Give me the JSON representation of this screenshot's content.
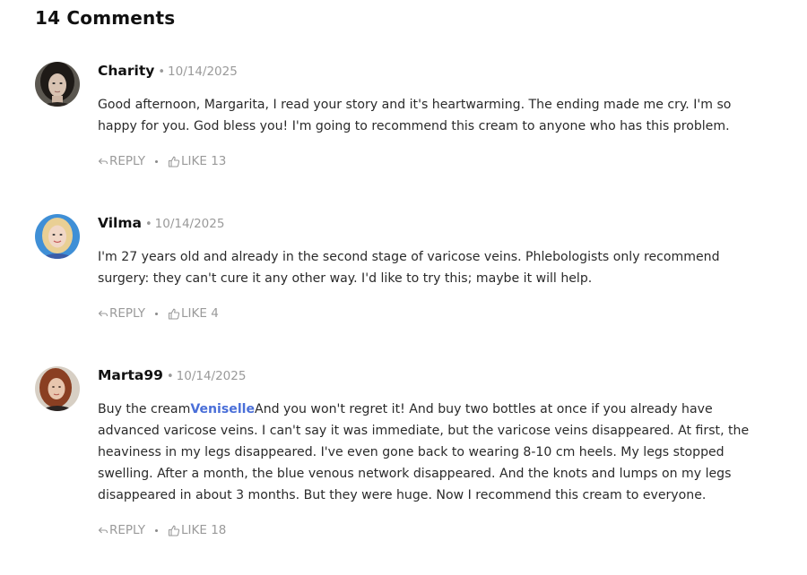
{
  "comments_heading": "14 Comments",
  "colors": {
    "link": "#4a6fd8",
    "muted": "#9a9a9a",
    "text": "#2a2a2a"
  },
  "comments": [
    {
      "author": "Charity",
      "date": "10/14/2025",
      "avatar_icon": "avatar-dark-hair-woman",
      "text": "Good afternoon, Margarita, I read your story and it's heartwarming. The ending made me cry. I'm so happy for you. God bless you! I'm going to recommend this cream to anyone who has this problem.",
      "reply_label": "REPLY",
      "like_label": "LIKE 13"
    },
    {
      "author": "Vilma",
      "date": "10/14/2025",
      "avatar_icon": "avatar-blonde-woman",
      "text": "I'm 27 years old and already in the second stage of varicose veins. Phlebologists only recommend surgery: they can't cure it any other way. I'd like to try this; maybe it will help.",
      "reply_label": "REPLY",
      "like_label": "LIKE 4"
    },
    {
      "author": "Marta99",
      "date": "10/14/2025",
      "avatar_icon": "avatar-red-hair-woman",
      "text_before": "Buy the cream",
      "link_text": "Veniselle",
      "text_after": "And you won't regret it! And buy two bottles at once if you already have advanced varicose veins. I can't say it was immediate, but the varicose veins disappeared. At first, the heaviness in my legs disappeared. I've even gone back to wearing 8-10 cm heels. My legs stopped swelling. After a month, the blue venous network disappeared. And the knots and lumps on my legs disappeared in about 3 months. But they were huge. Now I recommend this cream to everyone.",
      "reply_label": "REPLY",
      "like_label": "LIKE 18"
    }
  ]
}
